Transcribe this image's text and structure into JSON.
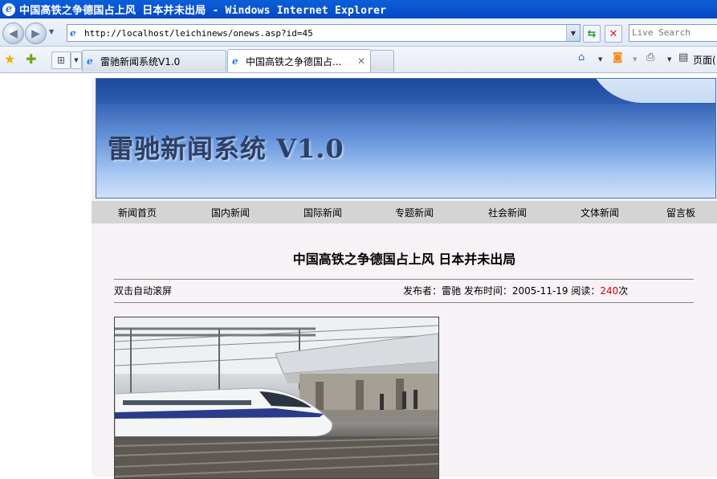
{
  "window": {
    "title": "中国高铁之争德国占上风 日本并未出局 - Windows Internet Explorer"
  },
  "address_bar": {
    "url": "http://localhost/leichinews/onews.asp?id=45"
  },
  "search": {
    "placeholder": "Live Search"
  },
  "tabs": [
    {
      "label": "雷驰新闻系统V1.0"
    },
    {
      "label": "中国高铁之争德国占..."
    }
  ],
  "command_bar": {
    "page_label": "页面("
  },
  "site": {
    "banner_title": "雷驰新闻系统 V1.0",
    "nav": [
      "新闻首页",
      "国内新闻",
      "国际新闻",
      "专题新闻",
      "社会新闻",
      "文体新闻",
      "留言板"
    ]
  },
  "article": {
    "title": "中国高铁之争德国占上风  日本并未出局",
    "scroll_hint": "双击自动滚屏",
    "meta_prefix": "发布者：雷驰  发布时间：2005-11-19  阅读：",
    "read_count": "240",
    "meta_suffix": "次"
  },
  "colors": {
    "accent": "#d00000",
    "titlebar": "#0a5fd8",
    "nav_bg": "#d4d4d4"
  }
}
